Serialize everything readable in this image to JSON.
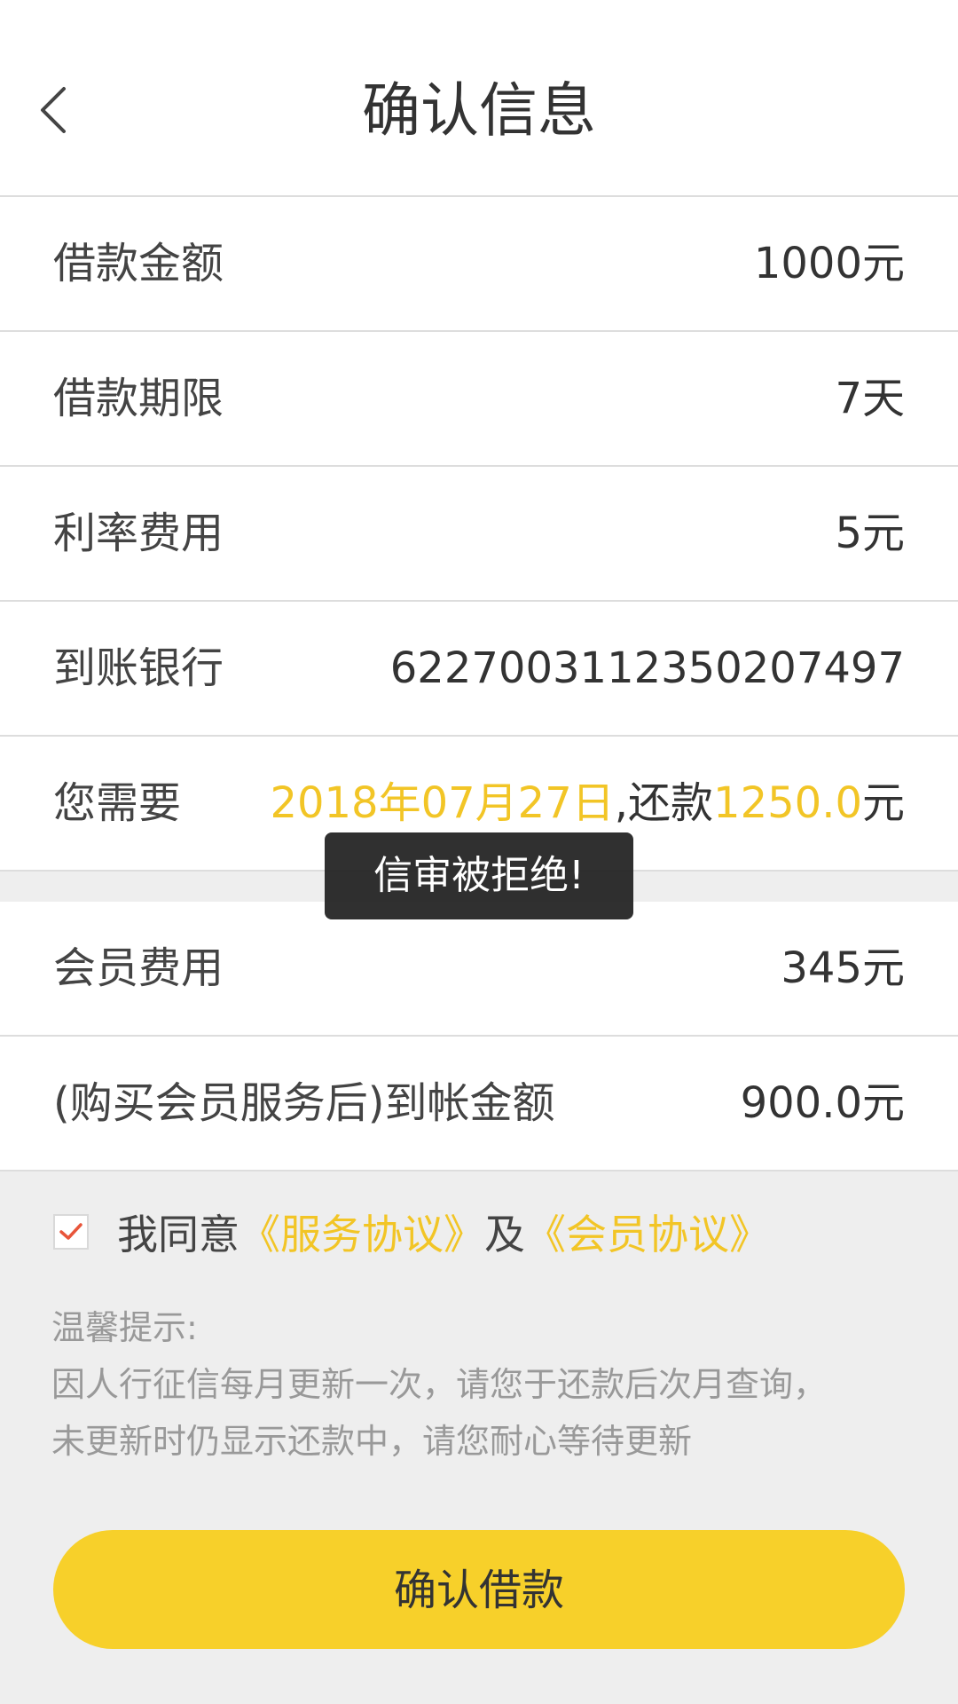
{
  "header": {
    "title": "确认信息",
    "back_icon": "chevron-left-icon"
  },
  "loan_details": [
    {
      "label": "借款金额",
      "value": "1000元"
    },
    {
      "label": "借款期限",
      "value": "7天"
    },
    {
      "label": "利率费用",
      "value": "5元"
    },
    {
      "label": "到账银行",
      "value": "6227003112350207497"
    }
  ],
  "repayment": {
    "label": "您需要",
    "date": "2018年07月27日",
    "sep": ",还款",
    "amount": "1250.0",
    "unit": "元"
  },
  "toast": {
    "message": "信审被拒绝!"
  },
  "member_details": [
    {
      "label": "会员费用",
      "value": "345元"
    },
    {
      "label": "(购买会员服务后)到帐金额",
      "value": "900.0元"
    }
  ],
  "agreement": {
    "checked": true,
    "prefix": "我同意",
    "service_link": "《服务协议》",
    "conj": "及",
    "member_link": "《会员协议》"
  },
  "tips": {
    "title": "温馨提示:",
    "line1": "因人行征信每月更新一次，请您于还款后次月查询，",
    "line2": "未更新时仍显示还款中，请您耐心等待更新"
  },
  "confirm_button": {
    "label": "确认借款"
  },
  "colors": {
    "accent": "#f2c526",
    "button": "#f7d02a",
    "checkmark": "#e8553a"
  }
}
